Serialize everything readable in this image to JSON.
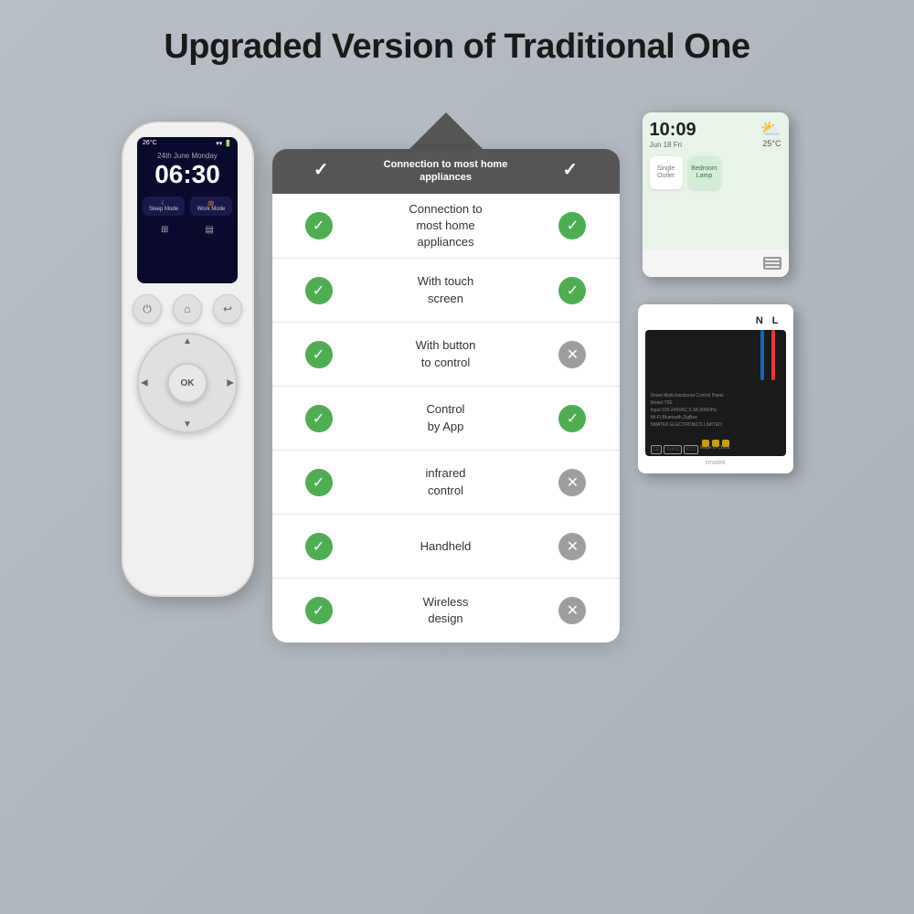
{
  "page": {
    "background_color": "#b0b8c1"
  },
  "title": "Upgraded Version of Traditional One",
  "comparison": {
    "col1_header": "✓",
    "feature_col_header": "Connection to most home appliances",
    "col2_header": "✓",
    "rows": [
      {
        "feature": "Connection to\nmost home\nappliances",
        "col1_check": true,
        "col2_check": true
      },
      {
        "feature": "With touch\nscreen",
        "col1_check": true,
        "col2_check": true
      },
      {
        "feature": "With button\nto control",
        "col1_check": true,
        "col2_check": false
      },
      {
        "feature": "Control\nby App",
        "col1_check": true,
        "col2_check": true
      },
      {
        "feature": "infrared\ncontrol",
        "col1_check": true,
        "col2_check": false
      },
      {
        "feature": "Handheld",
        "col1_check": true,
        "col2_check": false
      },
      {
        "feature": "Wireless\ndesign",
        "col1_check": true,
        "col2_check": false
      }
    ]
  },
  "remote": {
    "time": "06:30",
    "date": "24th June  Monday",
    "temperature": "26°C",
    "mode1": "Sleep Mode",
    "mode2": "Work Mode",
    "ok_label": "OK"
  },
  "touch_panel": {
    "time": "10:09",
    "date": "Jun 18 Fri",
    "temperature": "25°C",
    "app1": "Single\nOutlet",
    "app2": "Bedroom\nLamp"
  },
  "pcb": {
    "label_n": "N",
    "label_l": "L",
    "model_text": "Smart Multi-functional Control Panel\nModel:T6E\nInput:100-240VAC,0.3A,50/60Hz\nWi-Fi,Bluetooth,ZigBee\nSMATEK ELECTRONICS LIMITED"
  }
}
